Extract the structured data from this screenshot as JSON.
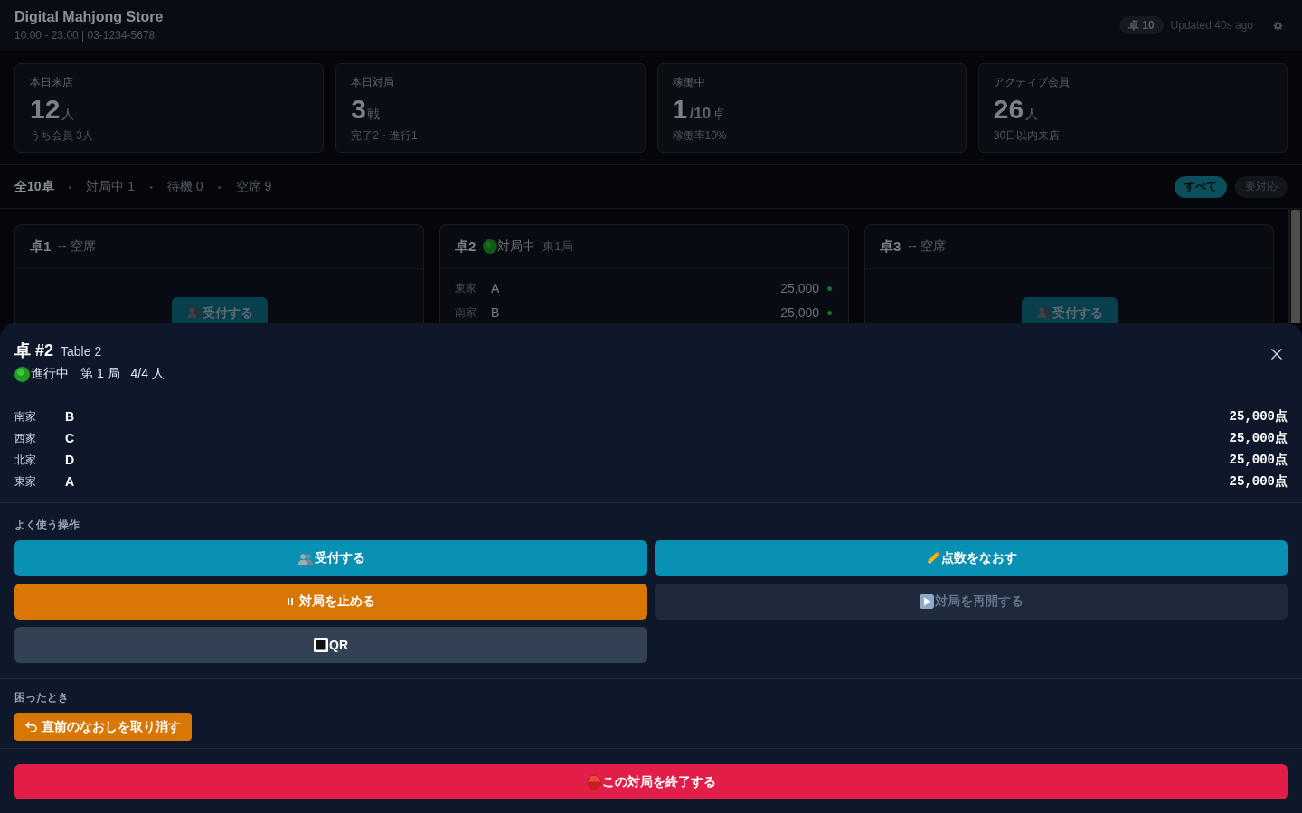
{
  "header": {
    "title": "Digital Mahjong Store",
    "subtitle": "10:00 - 23:00 | 03-1234-5678",
    "table_badge": "卓 10",
    "updated": "Updated 40s ago"
  },
  "stats": [
    {
      "label": "本日来店",
      "value": "12",
      "unit": "人",
      "note": "うち会員 3人"
    },
    {
      "label": "本日対局",
      "value": "3",
      "unit": "戦",
      "note": "完了2・進行1"
    },
    {
      "label": "稼働中",
      "value": "1",
      "suffix": "/10",
      "unit": "卓",
      "note": "稼働率10%"
    },
    {
      "label": "アクティブ会員",
      "value": "26",
      "unit": "人",
      "note": "30日以内来店"
    }
  ],
  "summary": {
    "total": "全10卓",
    "separator": "•",
    "counts": [
      "対局中 1",
      "待機 0",
      "空席 9"
    ]
  },
  "filters": [
    {
      "label": "すべて",
      "selected": true
    },
    {
      "label": "要対応",
      "selected": false
    }
  ],
  "tables": [
    {
      "kind": "vacant",
      "name": "卓1",
      "status": "-- 空席",
      "action": "受付する"
    },
    {
      "kind": "playing",
      "name": "卓2",
      "status": "対局中",
      "round": "東1局",
      "players": [
        {
          "seat": "東家",
          "name": "A",
          "score": "25,000",
          "connected": true
        },
        {
          "seat": "南家",
          "name": "B",
          "score": "25,000",
          "connected": true
        }
      ]
    },
    {
      "kind": "vacant",
      "name": "卓3",
      "status": "-- 空席",
      "action": "受付する"
    }
  ],
  "sheet": {
    "title": "卓 #2",
    "subtitle": "Table 2",
    "status": {
      "kind": "playing",
      "label": "進行中"
    },
    "round": "第 1 局",
    "seats": "4/4 人",
    "players": [
      {
        "seat": "南家",
        "name": "B",
        "score": "25,000点"
      },
      {
        "seat": "西家",
        "name": "C",
        "score": "25,000点"
      },
      {
        "seat": "北家",
        "name": "D",
        "score": "25,000点"
      },
      {
        "seat": "東家",
        "name": "A",
        "score": "25,000点"
      }
    ],
    "quick_actions": {
      "title": "よく使う操作",
      "buttons": [
        {
          "kind": "checkin",
          "label": "受付する",
          "disabled": false
        },
        {
          "kind": "score",
          "label": "点数をなおす",
          "disabled": false
        },
        {
          "kind": "pause",
          "label": "対局を止める",
          "disabled": false
        },
        {
          "kind": "resume",
          "label": "対局を再開する",
          "disabled": true
        },
        {
          "kind": "qr",
          "label": "QR",
          "disabled": false
        }
      ]
    },
    "trouble": {
      "title": "困ったとき",
      "button": "直前のなおしを取り消す"
    },
    "end_button": "この対局を終了する"
  }
}
